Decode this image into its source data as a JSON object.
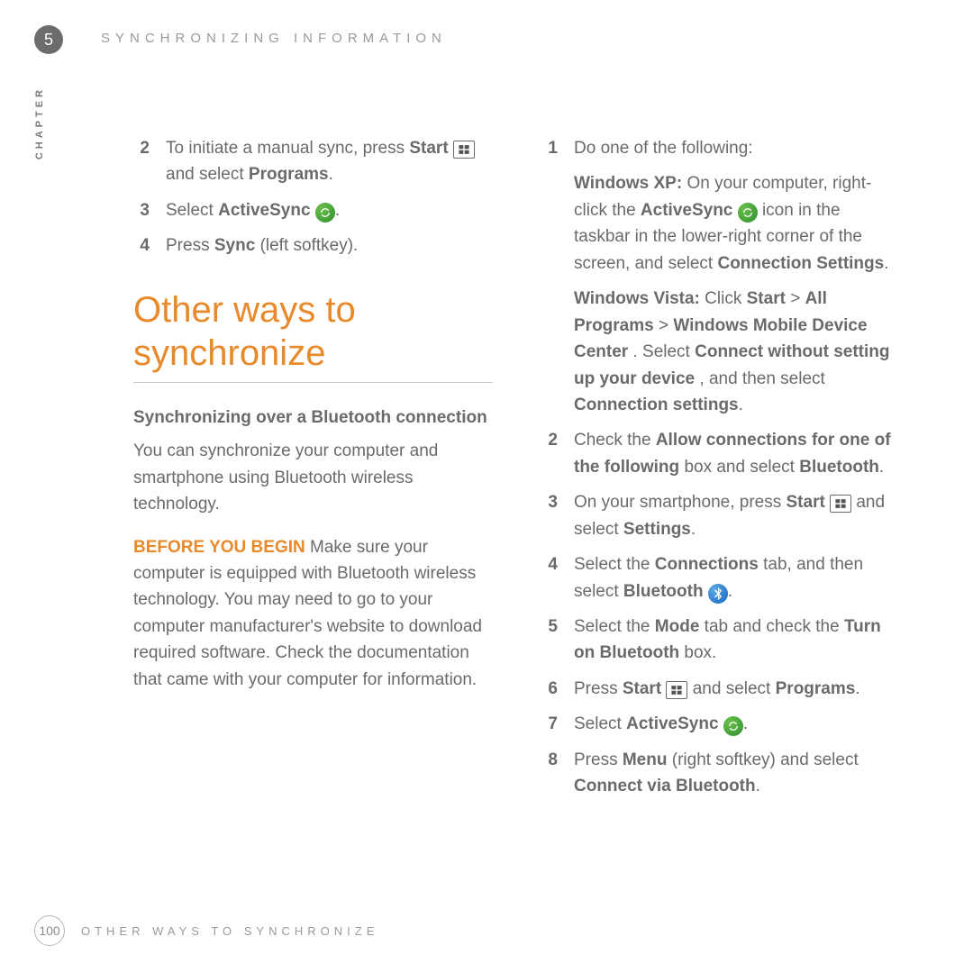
{
  "chapter_number": "5",
  "header_title": "SYNCHRONIZING INFORMATION",
  "vert_label": "CHAPTER",
  "left": {
    "step2_a": "To initiate a manual sync, press ",
    "step2_b_start": "Start",
    "step2_c": " and select ",
    "step2_d_programs": "Programs",
    "step2_e": ".",
    "step3_a": "Select ",
    "step3_b_active": "ActiveSync",
    "step3_c": ".",
    "step4_a": "Press ",
    "step4_b_sync": "Sync",
    "step4_c": " (left softkey).",
    "h1": "Other ways to synchronize",
    "subhead": "Synchronizing over a Bluetooth connection",
    "para1": "You can synchronize your computer and smartphone using Bluetooth wireless technology.",
    "byb_label": "BEFORE YOU BEGIN",
    "byb_text": "  Make sure your computer is equipped with Bluetooth wireless technology. You may need to go to your computer manufacturer's website to download required software. Check the documentation that came with your computer for information."
  },
  "right": {
    "s1_intro": "Do one of the following:",
    "s1_xp_label": "Windows XP:",
    "s1_xp_a": " On your computer, right-click the ",
    "s1_xp_active": "ActiveSync",
    "s1_xp_b": " icon in the taskbar in the lower-right corner of the screen, and select ",
    "s1_xp_conn": "Connection Settings",
    "s1_xp_c": ".",
    "s1_v_label": "Windows Vista:",
    "s1_v_a": " Click ",
    "s1_v_start": "Start",
    "s1_v_b": " > ",
    "s1_v_all": "All Programs",
    "s1_v_c": " > ",
    "s1_v_wmdc": "Windows Mobile Device Center",
    "s1_v_d": ". Select ",
    "s1_v_cwo": "Connect without setting up your device",
    "s1_v_e": ", and then select ",
    "s1_v_cs": "Connection settings",
    "s1_v_f": ".",
    "s2_a": "Check the ",
    "s2_b": "Allow connections for one of the following",
    "s2_c": " box and select ",
    "s2_d": "Bluetooth",
    "s2_e": ".",
    "s3_a": "On your smartphone, press ",
    "s3_b": "Start",
    "s3_c": " and select ",
    "s3_d": "Settings",
    "s3_e": ".",
    "s4_a": "Select the ",
    "s4_b": "Connections",
    "s4_c": " tab, and then select ",
    "s4_d": "Bluetooth",
    "s4_e": ".",
    "s5_a": "Select the ",
    "s5_b": "Mode",
    "s5_c": " tab and check the ",
    "s5_d": "Turn on Bluetooth",
    "s5_e": " box.",
    "s6_a": "Press ",
    "s6_b": "Start",
    "s6_c": " and select ",
    "s6_d": "Programs",
    "s6_e": ".",
    "s7_a": "Select ",
    "s7_b": "ActiveSync",
    "s7_c": ".",
    "s8_a": "Press ",
    "s8_b": "Menu",
    "s8_c": " (right softkey) and select ",
    "s8_d": "Connect via Bluetooth",
    "s8_e": "."
  },
  "footer": {
    "page_number": "100",
    "title": "OTHER WAYS TO SYNCHRONIZE"
  }
}
